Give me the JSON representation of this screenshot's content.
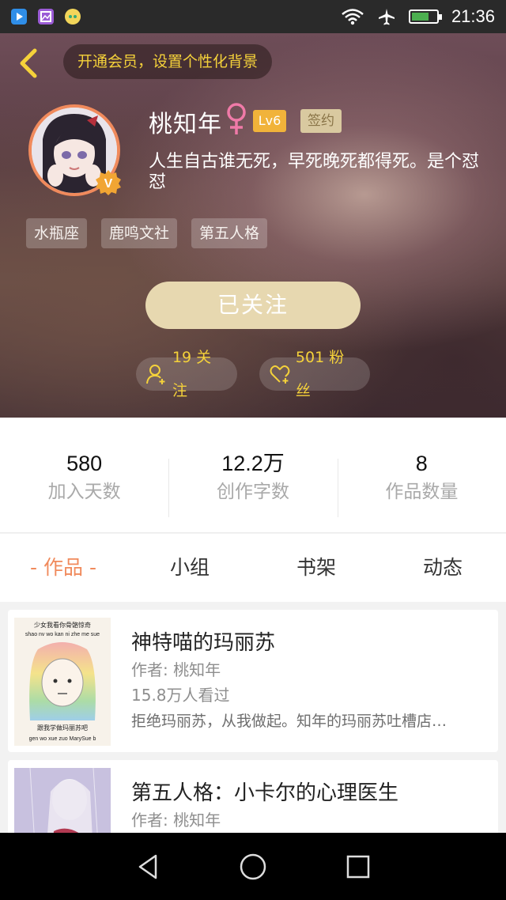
{
  "status_bar": {
    "time": "21:36",
    "icons": [
      "video-app-icon",
      "gallery-app-icon",
      "chat-app-icon",
      "wifi-icon",
      "airplane-icon",
      "battery-icon"
    ],
    "battery_level": 0.7
  },
  "header": {
    "vip_prompt": "开通会员，设置个性化背景",
    "username": "桃知年",
    "gender_symbol": "♀",
    "level": "Lv6",
    "signed_badge": "签约",
    "bio": "人生自古谁无死，早死晚死都得死。是个怼怼",
    "tags": [
      "水瓶座",
      "鹿鸣文社",
      "第五人格"
    ],
    "follow_button": "已关注",
    "following": "19 关注",
    "fans": "501 粉丝",
    "accent_color": "#f5d23a"
  },
  "stats": [
    {
      "value": "580",
      "label": "加入天数"
    },
    {
      "value": "12.2万",
      "label": "创作字数"
    },
    {
      "value": "8",
      "label": "作品数量"
    }
  ],
  "tabs": [
    {
      "label": "- 作品 -",
      "active": true
    },
    {
      "label": "小组",
      "active": false
    },
    {
      "label": "书架",
      "active": false
    },
    {
      "label": "动态",
      "active": false
    }
  ],
  "works": [
    {
      "title": "神特喵的玛丽苏",
      "author": "作者: 桃知年",
      "views": "15.8万人看过",
      "description": "拒绝玛丽苏，从我做起。知年的玛丽苏吐槽店…",
      "cover_text_top_cn": "少女我看你骨骼惊奇",
      "cover_text_top_py": "shao nv wo kan ni zhe me sue",
      "cover_text_bottom_cn": "跟我学做玛丽苏吧",
      "cover_text_bottom_py": "gen wo xue zuo MarySue b"
    },
    {
      "title": "第五人格：小卡尔的心理医生",
      "author": "作者: 桃知年",
      "views": "",
      "description": ""
    }
  ],
  "nav": [
    "back-triangle-icon",
    "home-circle-icon",
    "recent-square-icon"
  ]
}
